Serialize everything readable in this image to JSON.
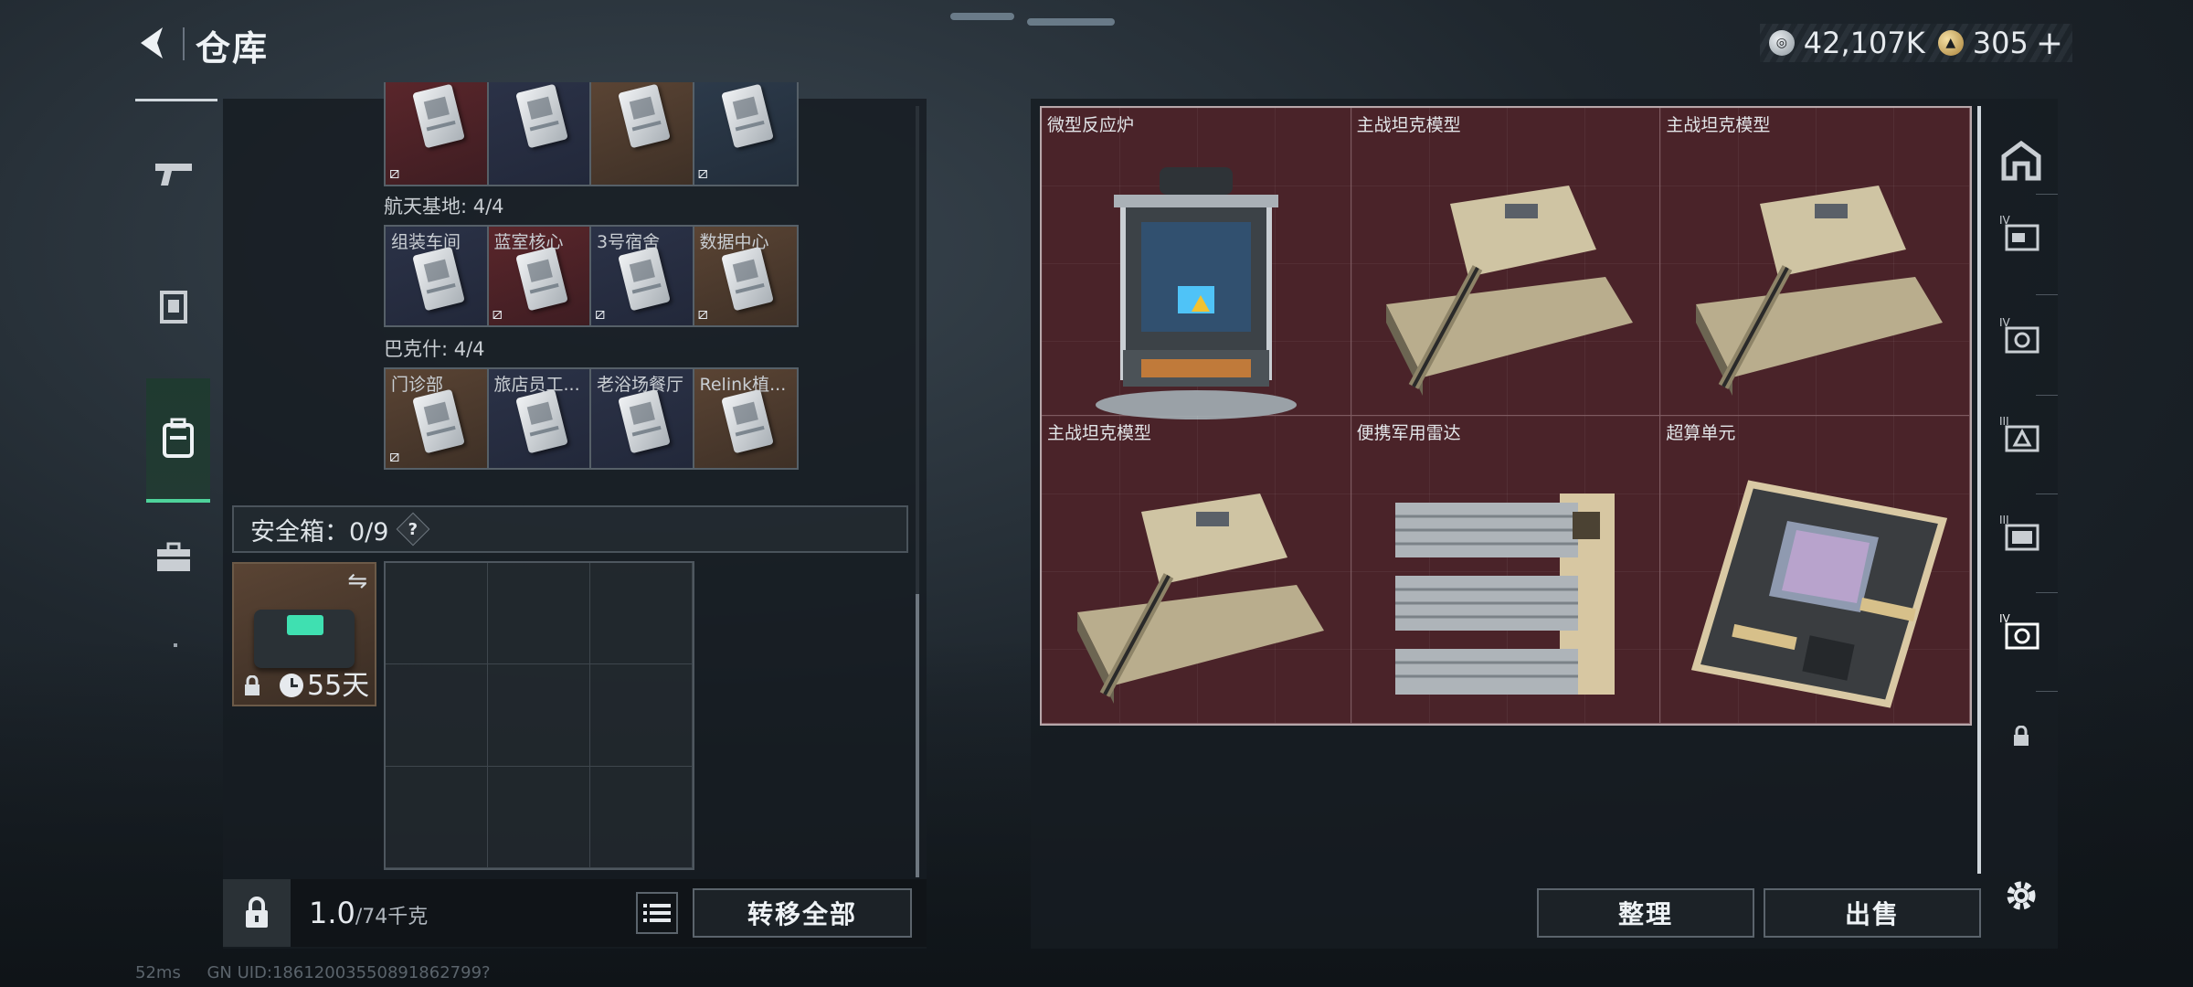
{
  "header": {
    "title": "仓库",
    "currency_silver": "42,107K",
    "currency_gold": "305",
    "add_symbol": "+"
  },
  "key_groups": [
    {
      "label": "",
      "keys": [
        {
          "name": "",
          "color": "red"
        },
        {
          "name": "",
          "color": "navy"
        },
        {
          "name": "",
          "color": "brown"
        },
        {
          "name": "",
          "color": "slate"
        }
      ]
    },
    {
      "label": "航天基地: 4/4",
      "keys": [
        {
          "name": "组装车间",
          "color": "navy"
        },
        {
          "name": "蓝室核心",
          "color": "red"
        },
        {
          "name": "3号宿舍",
          "color": "navy"
        },
        {
          "name": "数据中心",
          "color": "brown"
        }
      ]
    },
    {
      "label": "巴克什: 4/4",
      "keys": [
        {
          "name": "门诊部",
          "color": "brown"
        },
        {
          "name": "旅店员工...",
          "color": "navy"
        },
        {
          "name": "老浴场餐厅",
          "color": "navy"
        },
        {
          "name": "Relink植...",
          "color": "brown"
        }
      ]
    }
  ],
  "safe_box": {
    "label": "安全箱：0/9",
    "help": "?",
    "days": "55天"
  },
  "footer": {
    "weight": "1.0",
    "weight_max": "/74千克",
    "transfer_all": "转移全部"
  },
  "items": [
    {
      "name": "微型反应炉",
      "icon": "reactor-icon"
    },
    {
      "name": "主战坦克模型",
      "icon": "tank-icon"
    },
    {
      "name": "主战坦克模型",
      "icon": "tank-icon"
    },
    {
      "name": "主战坦克模型",
      "icon": "tank-icon"
    },
    {
      "name": "便携军用雷达",
      "icon": "radar-icon"
    },
    {
      "name": "超算单元",
      "icon": "supercomputer-icon"
    }
  ],
  "actions": {
    "sort": "整理",
    "sell": "出售"
  },
  "statusbar": {
    "ping": "52ms",
    "uid": "GN UID:18612003550891862799?"
  },
  "colors": {
    "accent_green": "#4ed39b",
    "item_bg_red": "#4a2329",
    "panel_bg": "#161c22"
  }
}
